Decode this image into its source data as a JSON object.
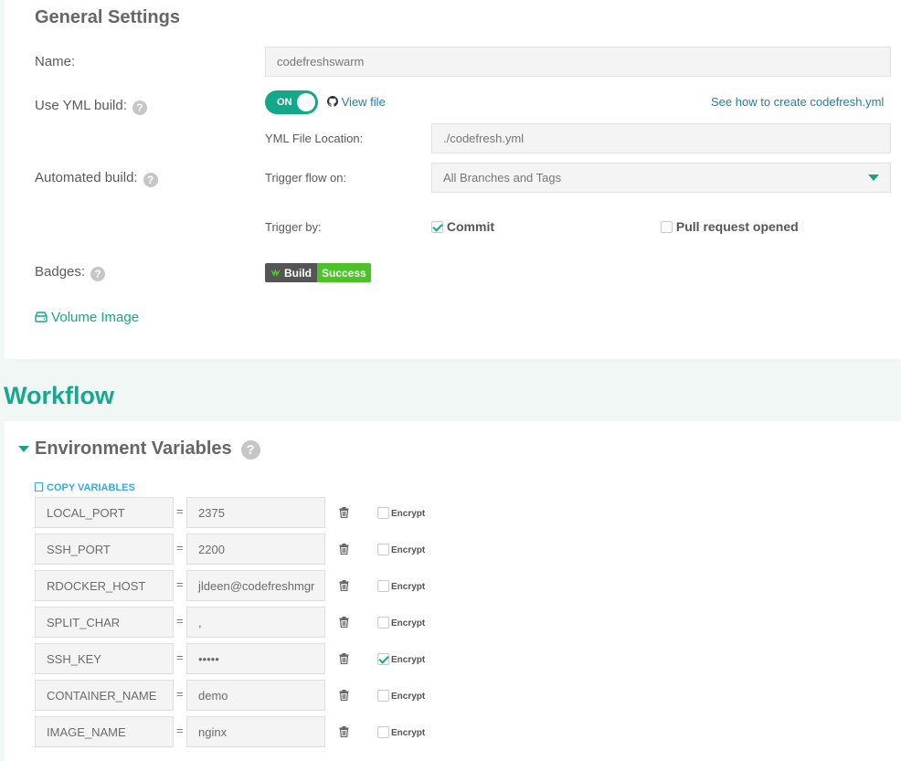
{
  "general": {
    "title": "General Settings",
    "name_label": "Name:",
    "name_value": "codefreshswarm",
    "yml_label": "Use YML build:",
    "toggle_label": "ON",
    "view_file": "View file",
    "how_to_link": "See how to create codefresh.yml",
    "yml_location_label": "YML File Location:",
    "yml_location_value": "./codefresh.yml",
    "automated_label": "Automated build:",
    "trigger_flow_label": "Trigger flow on:",
    "trigger_flow_value": "All Branches and Tags",
    "trigger_by_label": "Trigger by:",
    "commit_label": "Commit",
    "commit_checked": true,
    "pr_label": "Pull request opened",
    "pr_checked": false,
    "badges_label": "Badges:",
    "badge_left": "Build",
    "badge_right": "Success",
    "volume_link": "Volume Image"
  },
  "workflow": {
    "title": "Workflow",
    "env_title": "Environment Variables",
    "copy_label": "COPY VARIABLES",
    "encrypt_label": "Encrypt",
    "variables": [
      {
        "key": "LOCAL_PORT",
        "value": "2375",
        "encrypted": false
      },
      {
        "key": "SSH_PORT",
        "value": "2200",
        "encrypted": false
      },
      {
        "key": "RDOCKER_HOST",
        "value": "jldeen@codefreshmgr",
        "encrypted": false
      },
      {
        "key": "SPLIT_CHAR",
        "value": ",",
        "encrypted": false
      },
      {
        "key": "SSH_KEY",
        "value": "•••••",
        "encrypted": true
      },
      {
        "key": "CONTAINER_NAME",
        "value": "demo",
        "encrypted": false
      },
      {
        "key": "IMAGE_NAME",
        "value": "nginx",
        "encrypted": false
      }
    ]
  },
  "colors": {
    "accent": "#18a48a",
    "link": "#1e7ea9",
    "badge_success": "#4cc228"
  }
}
